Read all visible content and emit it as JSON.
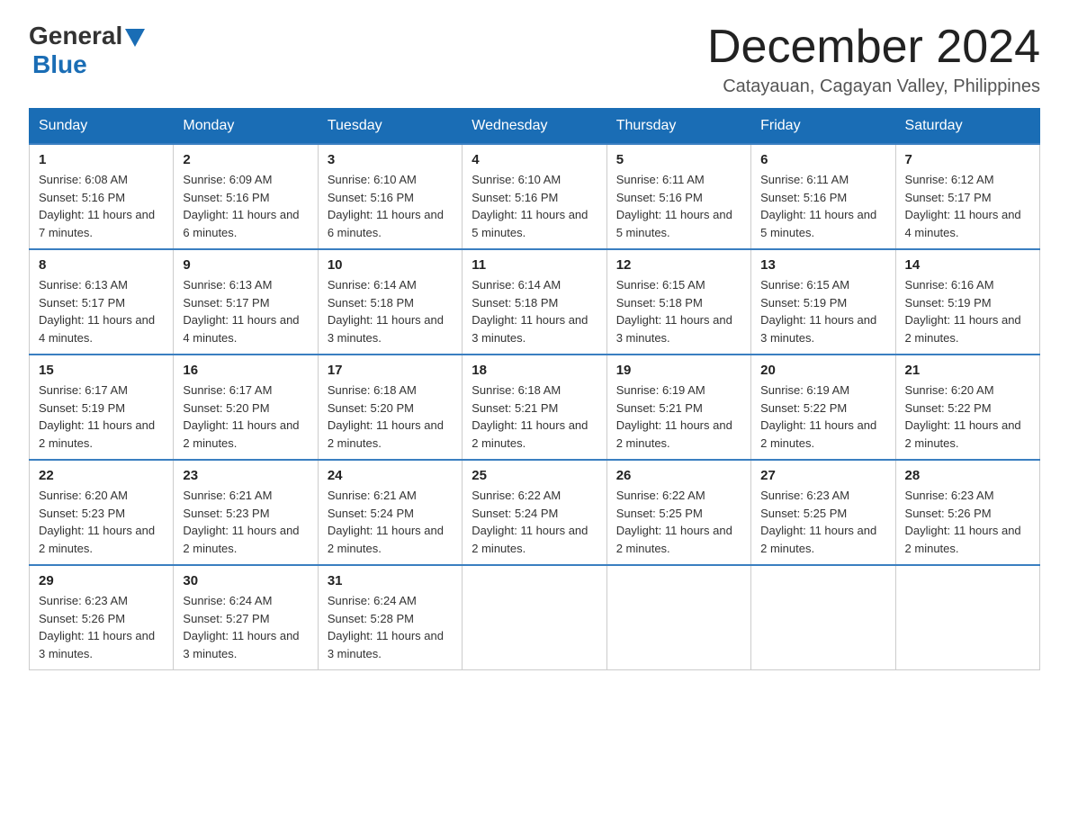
{
  "header": {
    "logo_general": "General",
    "logo_blue": "Blue",
    "month_title": "December 2024",
    "subtitle": "Catayauan, Cagayan Valley, Philippines"
  },
  "weekdays": [
    "Sunday",
    "Monday",
    "Tuesday",
    "Wednesday",
    "Thursday",
    "Friday",
    "Saturday"
  ],
  "weeks": [
    [
      {
        "day": "1",
        "sunrise": "6:08 AM",
        "sunset": "5:16 PM",
        "daylight": "11 hours and 7 minutes."
      },
      {
        "day": "2",
        "sunrise": "6:09 AM",
        "sunset": "5:16 PM",
        "daylight": "11 hours and 6 minutes."
      },
      {
        "day": "3",
        "sunrise": "6:10 AM",
        "sunset": "5:16 PM",
        "daylight": "11 hours and 6 minutes."
      },
      {
        "day": "4",
        "sunrise": "6:10 AM",
        "sunset": "5:16 PM",
        "daylight": "11 hours and 5 minutes."
      },
      {
        "day": "5",
        "sunrise": "6:11 AM",
        "sunset": "5:16 PM",
        "daylight": "11 hours and 5 minutes."
      },
      {
        "day": "6",
        "sunrise": "6:11 AM",
        "sunset": "5:16 PM",
        "daylight": "11 hours and 5 minutes."
      },
      {
        "day": "7",
        "sunrise": "6:12 AM",
        "sunset": "5:17 PM",
        "daylight": "11 hours and 4 minutes."
      }
    ],
    [
      {
        "day": "8",
        "sunrise": "6:13 AM",
        "sunset": "5:17 PM",
        "daylight": "11 hours and 4 minutes."
      },
      {
        "day": "9",
        "sunrise": "6:13 AM",
        "sunset": "5:17 PM",
        "daylight": "11 hours and 4 minutes."
      },
      {
        "day": "10",
        "sunrise": "6:14 AM",
        "sunset": "5:18 PM",
        "daylight": "11 hours and 3 minutes."
      },
      {
        "day": "11",
        "sunrise": "6:14 AM",
        "sunset": "5:18 PM",
        "daylight": "11 hours and 3 minutes."
      },
      {
        "day": "12",
        "sunrise": "6:15 AM",
        "sunset": "5:18 PM",
        "daylight": "11 hours and 3 minutes."
      },
      {
        "day": "13",
        "sunrise": "6:15 AM",
        "sunset": "5:19 PM",
        "daylight": "11 hours and 3 minutes."
      },
      {
        "day": "14",
        "sunrise": "6:16 AM",
        "sunset": "5:19 PM",
        "daylight": "11 hours and 2 minutes."
      }
    ],
    [
      {
        "day": "15",
        "sunrise": "6:17 AM",
        "sunset": "5:19 PM",
        "daylight": "11 hours and 2 minutes."
      },
      {
        "day": "16",
        "sunrise": "6:17 AM",
        "sunset": "5:20 PM",
        "daylight": "11 hours and 2 minutes."
      },
      {
        "day": "17",
        "sunrise": "6:18 AM",
        "sunset": "5:20 PM",
        "daylight": "11 hours and 2 minutes."
      },
      {
        "day": "18",
        "sunrise": "6:18 AM",
        "sunset": "5:21 PM",
        "daylight": "11 hours and 2 minutes."
      },
      {
        "day": "19",
        "sunrise": "6:19 AM",
        "sunset": "5:21 PM",
        "daylight": "11 hours and 2 minutes."
      },
      {
        "day": "20",
        "sunrise": "6:19 AM",
        "sunset": "5:22 PM",
        "daylight": "11 hours and 2 minutes."
      },
      {
        "day": "21",
        "sunrise": "6:20 AM",
        "sunset": "5:22 PM",
        "daylight": "11 hours and 2 minutes."
      }
    ],
    [
      {
        "day": "22",
        "sunrise": "6:20 AM",
        "sunset": "5:23 PM",
        "daylight": "11 hours and 2 minutes."
      },
      {
        "day": "23",
        "sunrise": "6:21 AM",
        "sunset": "5:23 PM",
        "daylight": "11 hours and 2 minutes."
      },
      {
        "day": "24",
        "sunrise": "6:21 AM",
        "sunset": "5:24 PM",
        "daylight": "11 hours and 2 minutes."
      },
      {
        "day": "25",
        "sunrise": "6:22 AM",
        "sunset": "5:24 PM",
        "daylight": "11 hours and 2 minutes."
      },
      {
        "day": "26",
        "sunrise": "6:22 AM",
        "sunset": "5:25 PM",
        "daylight": "11 hours and 2 minutes."
      },
      {
        "day": "27",
        "sunrise": "6:23 AM",
        "sunset": "5:25 PM",
        "daylight": "11 hours and 2 minutes."
      },
      {
        "day": "28",
        "sunrise": "6:23 AM",
        "sunset": "5:26 PM",
        "daylight": "11 hours and 2 minutes."
      }
    ],
    [
      {
        "day": "29",
        "sunrise": "6:23 AM",
        "sunset": "5:26 PM",
        "daylight": "11 hours and 3 minutes."
      },
      {
        "day": "30",
        "sunrise": "6:24 AM",
        "sunset": "5:27 PM",
        "daylight": "11 hours and 3 minutes."
      },
      {
        "day": "31",
        "sunrise": "6:24 AM",
        "sunset": "5:28 PM",
        "daylight": "11 hours and 3 minutes."
      },
      null,
      null,
      null,
      null
    ]
  ]
}
